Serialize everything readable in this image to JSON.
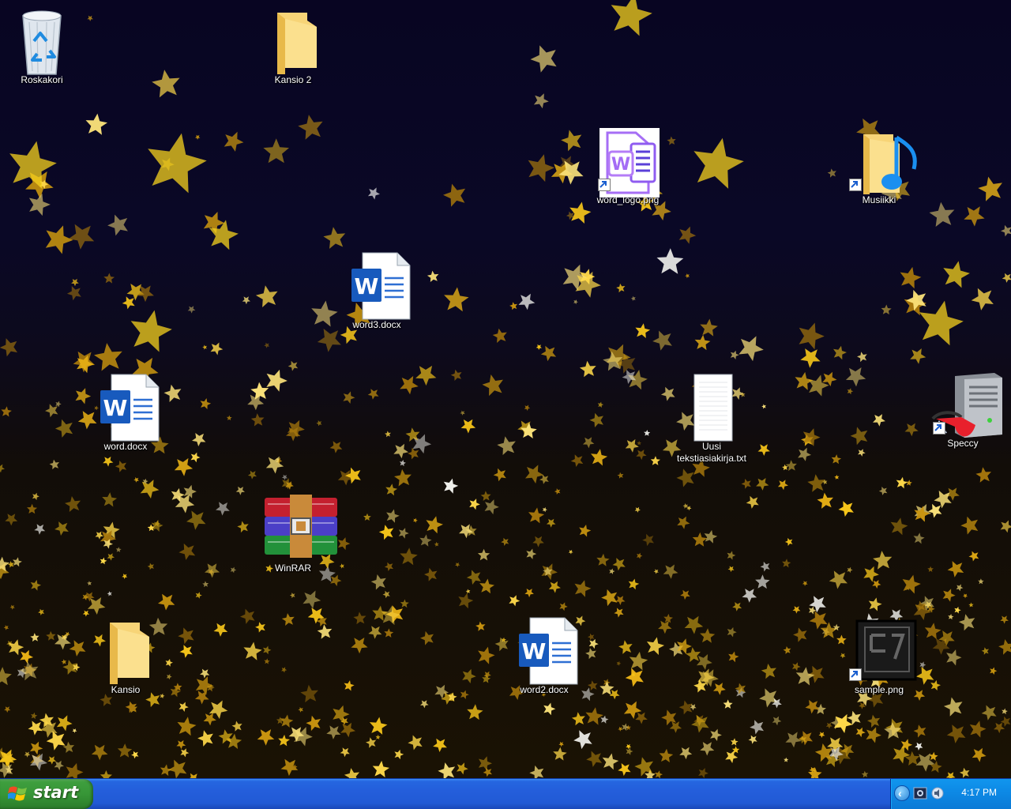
{
  "desktop": {
    "icons": [
      {
        "id": "roskakori",
        "label": "Roskakori",
        "kind": "recycle-bin"
      },
      {
        "id": "kansio2",
        "label": "Kansio 2",
        "kind": "folder"
      },
      {
        "id": "word_logo",
        "label": "word_logo.png",
        "kind": "image-shortcut"
      },
      {
        "id": "musiikki",
        "label": "Musiikki",
        "kind": "music-folder-shortcut"
      },
      {
        "id": "word3",
        "label": "word3.docx",
        "kind": "word-doc"
      },
      {
        "id": "word",
        "label": "word.docx",
        "kind": "word-doc"
      },
      {
        "id": "uusi",
        "label": "Uusi tekstiasiakirja.txt",
        "kind": "text-file"
      },
      {
        "id": "speccy",
        "label": "Speccy",
        "kind": "app-shortcut"
      },
      {
        "id": "winrar",
        "label": "WinRAR",
        "kind": "winrar"
      },
      {
        "id": "kansio",
        "label": "Kansio",
        "kind": "folder"
      },
      {
        "id": "word2",
        "label": "word2.docx",
        "kind": "word-doc"
      },
      {
        "id": "sample",
        "label": "sample.png",
        "kind": "image-shortcut"
      }
    ]
  },
  "taskbar": {
    "start_label": "start",
    "clock": "4:17 PM",
    "tray_icons": [
      "show-hidden-icons",
      "network-icon",
      "volume-icon"
    ]
  },
  "colors": {
    "taskbar_blue": "#245edb",
    "start_green": "#379637",
    "tray_blue": "#0d8ae6",
    "folder_yellow": "#f5cf6a",
    "word_blue": "#185abd"
  }
}
